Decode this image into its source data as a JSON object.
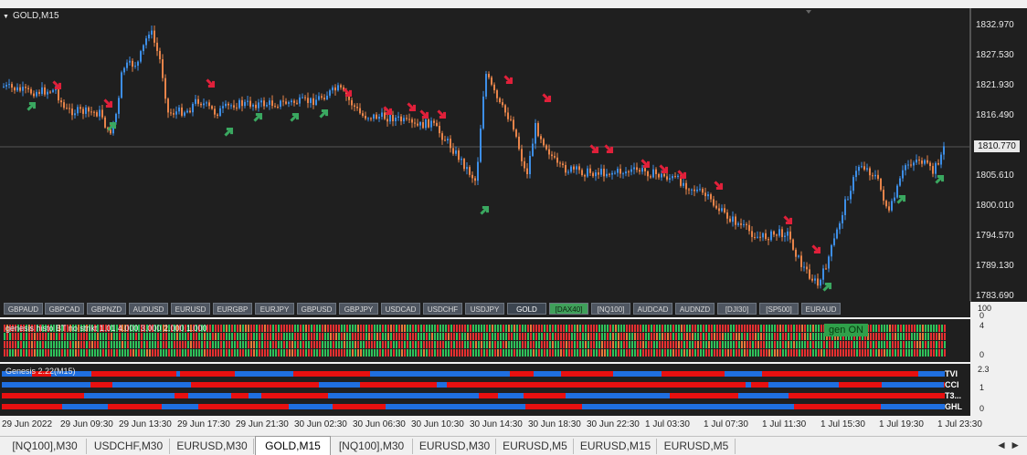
{
  "chart": {
    "title": "GOLD,M15",
    "current_price": "1810.770",
    "price_labels": [
      "1832.970",
      "1827.530",
      "1821.930",
      "1816.490",
      "1810.770",
      "1805.610",
      "1800.010",
      "1794.570",
      "1789.130",
      "1783.690"
    ],
    "colors": {
      "bull": "#3d8ee6",
      "bear": "#e8844a",
      "up_arrow": "#3aa860",
      "down_arrow": "#e0203a",
      "background": "#1f1f1f"
    }
  },
  "symbols": [
    {
      "label": "GBPAUD"
    },
    {
      "label": "GBPCAD"
    },
    {
      "label": "GBPNZD"
    },
    {
      "label": "AUDUSD"
    },
    {
      "label": "EURUSD"
    },
    {
      "label": "EURGBP"
    },
    {
      "label": "EURJPY"
    },
    {
      "label": "GBPUSD"
    },
    {
      "label": "GBPJPY"
    },
    {
      "label": "USDCAD"
    },
    {
      "label": "USDCHF"
    },
    {
      "label": "USDJPY"
    },
    {
      "label": "GOLD",
      "state": "active"
    },
    {
      "label": "[DAX40]",
      "state": "green"
    },
    {
      "label": "[NQ100]"
    },
    {
      "label": "AUDCAD"
    },
    {
      "label": "AUDNZD"
    },
    {
      "label": "[DJI30]"
    },
    {
      "label": "[SP500]"
    },
    {
      "label": "EURAUD"
    }
  ],
  "indicator1": {
    "label": "genesis histo BT no strikt 1.01 4.000 3.000 2.000 1.000",
    "status": "gen ON",
    "scale": [
      "100",
      "4",
      "0",
      "0"
    ]
  },
  "indicator2": {
    "label": "Genesis 2.22(M15)",
    "rows": [
      "TVI",
      "CCI",
      "T3...",
      "GHL"
    ],
    "scale": [
      "2.3",
      "1",
      "0"
    ]
  },
  "time_axis": [
    "29 Jun 2022",
    "29 Jun 09:30",
    "29 Jun 13:30",
    "29 Jun 17:30",
    "29 Jun 21:30",
    "30 Jun 02:30",
    "30 Jun 06:30",
    "30 Jun 10:30",
    "30 Jun 14:30",
    "30 Jun 18:30",
    "30 Jun 22:30",
    "1 Jul 03:30",
    "1 Jul 07:30",
    "1 Jul 11:30",
    "1 Jul 15:30",
    "1 Jul 19:30",
    "1 Jul 23:30"
  ],
  "tabs": [
    {
      "label": "[NQ100],M30"
    },
    {
      "label": "USDCHF,M30"
    },
    {
      "label": "EURUSD,M30"
    },
    {
      "label": "GOLD,M15",
      "active": true
    },
    {
      "label": "[NQ100],M30"
    },
    {
      "label": "EURUSD,M30"
    },
    {
      "label": "EURUSD,M5"
    },
    {
      "label": "EURUSD,M15"
    },
    {
      "label": "EURUSD,M5"
    }
  ],
  "tab_scroll": "◄ ►"
}
